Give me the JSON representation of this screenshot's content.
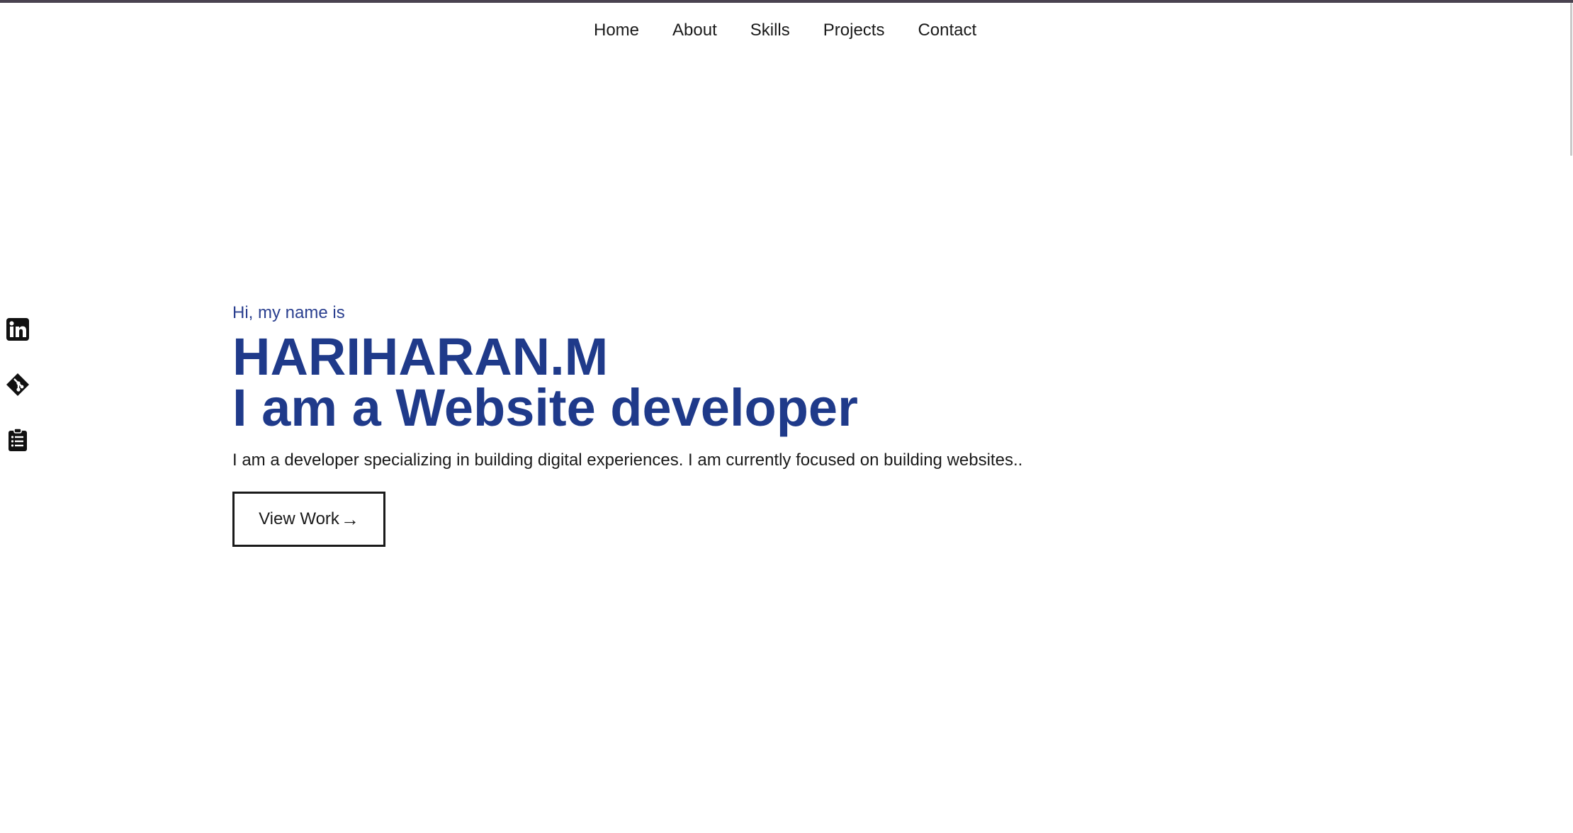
{
  "nav": {
    "items": [
      {
        "label": "Home"
      },
      {
        "label": "About"
      },
      {
        "label": "Skills"
      },
      {
        "label": "Projects"
      },
      {
        "label": "Contact"
      }
    ]
  },
  "social": {
    "items": [
      {
        "icon": "linkedin-icon"
      },
      {
        "icon": "git-icon"
      },
      {
        "icon": "resume-clipboard-icon"
      }
    ]
  },
  "hero": {
    "greeting": "Hi, my name is",
    "name": "HARIHARAN.M",
    "role": "I am a Website developer",
    "description": "I am a developer specializing in building digital experiences. I am currently focused on building websites..",
    "cta_label": "View Work",
    "cta_arrow": "→"
  },
  "colors": {
    "accent": "#1f3a8a",
    "text": "#1a1a1a",
    "background": "#ffffff"
  }
}
